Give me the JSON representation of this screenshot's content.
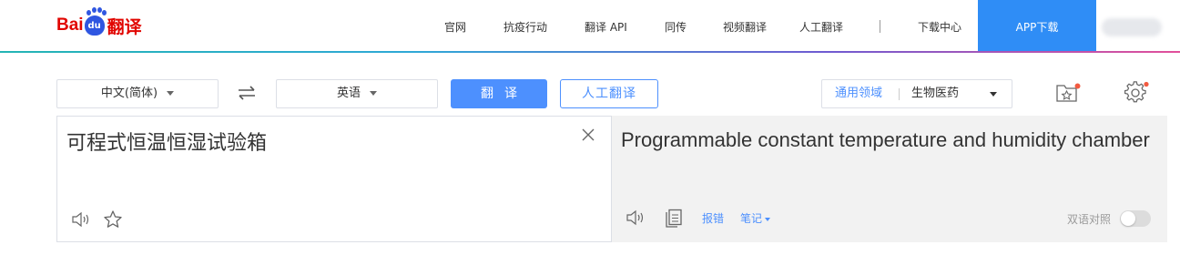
{
  "brand": {
    "logo_prefix": "Bai",
    "logo_paw": "du",
    "logo_suffix": "翻译",
    "brand_red": "#e10601",
    "brand_blue": "#2f56e1"
  },
  "nav": {
    "items": [
      "官网",
      "抗疫行动",
      "翻译 API",
      "同传",
      "视频翻译",
      "人工翻译",
      "下载中心"
    ],
    "app_download": "APP下载",
    "accent": "#2f8df6"
  },
  "controls": {
    "source_lang": "中文(简体)",
    "target_lang": "英语",
    "swap_icon": "swap-arrows-icon",
    "translate_label": "翻译",
    "human_translate_label": "人工翻译",
    "domain_label": "通用领域",
    "domain_value": "生物医药",
    "favorites_icon": "favorites-folder-icon",
    "settings_icon": "gear-icon"
  },
  "source": {
    "text": "可程式恒温恒湿试验箱",
    "clear_icon": "close-icon",
    "speaker_icon": "speaker-icon",
    "star_icon": "star-icon"
  },
  "target": {
    "text": "Programmable constant temperature and humidity chamber",
    "speaker_icon": "speaker-icon",
    "copy_icon": "copy-icon",
    "report_label": "报错",
    "notes_label": "笔记",
    "bilingual_label": "双语对照",
    "bilingual_on": false
  }
}
